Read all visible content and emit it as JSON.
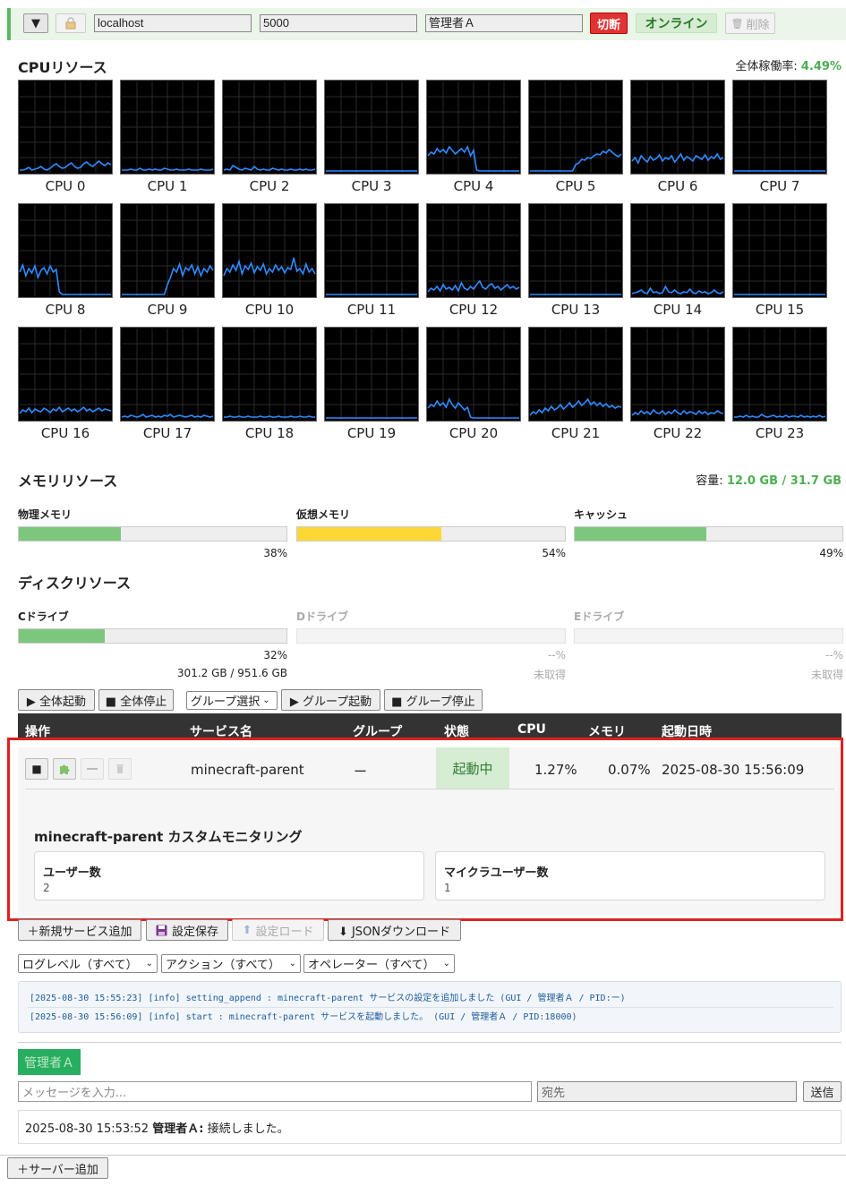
{
  "topbar": {
    "toggle_icon": "▼",
    "host_value": "localhost",
    "port_value": "5000",
    "operator_value": "管理者Ａ",
    "disconnect_label": "切断",
    "online_label": "オンライン",
    "delete_label": "削除"
  },
  "cpu_section": {
    "title": "CPUリソース",
    "usage_label": "全体稼働率:",
    "usage_value": "4.49%",
    "cores": [
      {
        "label": "CPU 0",
        "series": [
          2,
          2,
          3,
          5,
          2,
          3,
          4,
          6,
          3,
          2,
          4,
          7,
          9,
          6,
          4,
          5,
          8,
          10,
          6,
          4,
          5,
          9,
          11,
          8,
          6,
          9,
          12,
          9,
          7,
          10,
          8
        ]
      },
      {
        "label": "CPU 1",
        "series": [
          2,
          2,
          2,
          3,
          2,
          2,
          4,
          2,
          2,
          3,
          2,
          3,
          2,
          2,
          4,
          3,
          2,
          2,
          3,
          2,
          2,
          2,
          3,
          2,
          2,
          2,
          3,
          2,
          2,
          2,
          3
        ]
      },
      {
        "label": "CPU 2",
        "series": [
          2,
          3,
          2,
          7,
          5,
          3,
          2,
          4,
          3,
          2,
          6,
          3,
          2,
          3,
          2,
          2,
          4,
          3,
          2,
          3,
          2,
          2,
          3,
          2,
          2,
          3,
          2,
          3,
          2,
          2,
          3
        ]
      },
      {
        "label": "CPU 3",
        "series": [
          1,
          1,
          1,
          1,
          1,
          1,
          1,
          1,
          1,
          1,
          1,
          1,
          1,
          1,
          1,
          1,
          1,
          1,
          1,
          1,
          1,
          1,
          1,
          1,
          1,
          1,
          1,
          1,
          1,
          1,
          1
        ]
      },
      {
        "label": "CPU 4",
        "series": [
          18,
          22,
          20,
          26,
          22,
          25,
          21,
          28,
          24,
          20,
          23,
          26,
          22,
          28,
          18,
          24,
          2,
          1,
          1,
          1,
          1,
          1,
          1,
          1,
          1,
          1,
          1,
          1,
          1,
          1,
          1
        ]
      },
      {
        "label": "CPU 5",
        "series": [
          1,
          1,
          1,
          1,
          1,
          1,
          1,
          1,
          1,
          1,
          1,
          1,
          1,
          1,
          1,
          8,
          10,
          14,
          13,
          16,
          15,
          18,
          20,
          19,
          23,
          21,
          25,
          22,
          19,
          17,
          20
        ]
      },
      {
        "label": "CPU 6",
        "series": [
          12,
          16,
          10,
          18,
          14,
          11,
          17,
          13,
          15,
          19,
          12,
          16,
          14,
          18,
          11,
          15,
          20,
          13,
          17,
          15,
          12,
          18,
          16,
          14,
          19,
          13,
          17,
          15,
          20,
          14,
          16
        ]
      },
      {
        "label": "CPU 7",
        "series": [
          1,
          1,
          1,
          1,
          1,
          1,
          1,
          1,
          1,
          1,
          1,
          1,
          1,
          1,
          1,
          1,
          1,
          1,
          1,
          1,
          1,
          1,
          1,
          1,
          1,
          1,
          1,
          1,
          1,
          1,
          1
        ]
      },
      {
        "label": "CPU 8",
        "series": [
          26,
          34,
          22,
          30,
          25,
          33,
          20,
          28,
          31,
          24,
          33,
          26,
          29,
          4,
          1,
          1,
          1,
          1,
          1,
          1,
          1,
          1,
          1,
          1,
          1,
          1,
          1,
          1,
          1,
          1,
          1
        ]
      },
      {
        "label": "CPU 9",
        "series": [
          1,
          1,
          1,
          1,
          1,
          1,
          1,
          1,
          1,
          1,
          1,
          1,
          1,
          1,
          1,
          12,
          20,
          30,
          26,
          35,
          22,
          31,
          28,
          34,
          24,
          32,
          22,
          30,
          26,
          33,
          28
        ]
      },
      {
        "label": "CPU 10",
        "series": [
          22,
          30,
          26,
          34,
          28,
          38,
          24,
          33,
          29,
          36,
          25,
          32,
          28,
          35,
          24,
          30,
          26,
          34,
          28,
          32,
          25,
          31,
          29,
          42,
          27,
          30,
          24,
          35,
          26,
          30,
          24
        ]
      },
      {
        "label": "CPU 11",
        "series": [
          1,
          1,
          1,
          1,
          1,
          1,
          1,
          1,
          1,
          1,
          1,
          1,
          1,
          1,
          1,
          1,
          1,
          1,
          1,
          1,
          1,
          1,
          1,
          1,
          1,
          1,
          1,
          1,
          1,
          1,
          1
        ]
      },
      {
        "label": "CPU 12",
        "series": [
          4,
          8,
          6,
          10,
          5,
          12,
          7,
          9,
          6,
          11,
          5,
          14,
          8,
          6,
          10,
          7,
          12,
          16,
          9,
          7,
          11,
          13,
          8,
          10,
          6,
          9,
          12,
          8,
          10,
          7,
          9
        ]
      },
      {
        "label": "CPU 13",
        "series": [
          1,
          1,
          1,
          1,
          1,
          1,
          1,
          1,
          1,
          1,
          1,
          1,
          1,
          1,
          1,
          1,
          1,
          1,
          1,
          1,
          1,
          1,
          1,
          1,
          1,
          1,
          1,
          1,
          1,
          1,
          1
        ]
      },
      {
        "label": "CPU 14",
        "series": [
          2,
          3,
          4,
          6,
          3,
          2,
          8,
          3,
          4,
          2,
          3,
          10,
          4,
          3,
          6,
          3,
          2,
          4,
          3,
          7,
          3,
          2,
          5,
          3,
          4,
          2,
          3,
          6,
          3,
          2,
          4
        ]
      },
      {
        "label": "CPU 15",
        "series": [
          1,
          1,
          1,
          1,
          1,
          1,
          1,
          1,
          1,
          1,
          1,
          1,
          1,
          1,
          1,
          1,
          1,
          1,
          1,
          1,
          1,
          1,
          1,
          1,
          1,
          1,
          1,
          1,
          1,
          1,
          1
        ]
      },
      {
        "label": "CPU 16",
        "series": [
          6,
          10,
          8,
          12,
          7,
          11,
          9,
          8,
          12,
          10,
          7,
          11,
          9,
          13,
          8,
          10,
          12,
          9,
          11,
          8,
          10,
          13,
          9,
          11,
          8,
          10,
          12,
          9,
          11,
          10,
          9
        ]
      },
      {
        "label": "CPU 17",
        "series": [
          2,
          3,
          2,
          4,
          3,
          2,
          3,
          5,
          2,
          3,
          4,
          2,
          3,
          2,
          4,
          3,
          5,
          2,
          3,
          4,
          3,
          2,
          3,
          4,
          2,
          3,
          2,
          4,
          3,
          2,
          3
        ]
      },
      {
        "label": "CPU 18",
        "series": [
          2,
          2,
          3,
          2,
          2,
          3,
          2,
          2,
          3,
          2,
          2,
          2,
          3,
          2,
          2,
          3,
          2,
          2,
          3,
          2,
          2,
          2,
          3,
          2,
          2,
          3,
          2,
          2,
          3,
          2,
          2
        ]
      },
      {
        "label": "CPU 19",
        "series": [
          1,
          1,
          1,
          1,
          1,
          1,
          1,
          1,
          1,
          1,
          1,
          1,
          1,
          1,
          1,
          1,
          1,
          1,
          1,
          1,
          1,
          1,
          1,
          1,
          1,
          1,
          1,
          1,
          1,
          1,
          1
        ]
      },
      {
        "label": "CPU 20",
        "series": [
          12,
          16,
          14,
          20,
          15,
          18,
          13,
          22,
          16,
          12,
          18,
          14,
          10,
          13,
          2,
          1,
          1,
          1,
          1,
          1,
          1,
          1,
          1,
          1,
          1,
          1,
          1,
          1,
          1,
          1,
          1
        ]
      },
      {
        "label": "CPU 21",
        "series": [
          4,
          8,
          6,
          10,
          7,
          12,
          9,
          14,
          10,
          12,
          16,
          11,
          14,
          18,
          13,
          16,
          20,
          15,
          18,
          22,
          16,
          19,
          15,
          18,
          14,
          17,
          13,
          15,
          12,
          14,
          13
        ]
      },
      {
        "label": "CPU 22",
        "series": [
          4,
          7,
          5,
          9,
          6,
          8,
          5,
          10,
          7,
          6,
          9,
          5,
          8,
          6,
          10,
          7,
          5,
          9,
          6,
          8,
          7,
          5,
          9,
          6,
          8,
          5,
          7,
          6,
          9,
          7,
          6
        ]
      },
      {
        "label": "CPU 23",
        "series": [
          2,
          2,
          3,
          2,
          4,
          2,
          3,
          2,
          2,
          5,
          3,
          2,
          3,
          4,
          2,
          3,
          2,
          4,
          2,
          3,
          3,
          2,
          4,
          2,
          3,
          2,
          3,
          2,
          4,
          2,
          3
        ]
      }
    ]
  },
  "memory_section": {
    "title": "メモリリソース",
    "capacity_label": "容量:",
    "capacity_value": "12.0 GB / 31.7 GB",
    "meters": [
      {
        "title": "物理メモリ",
        "percent_text": "38%",
        "fraction": 0.38,
        "color": "#7dc67d"
      },
      {
        "title": "仮想メモリ",
        "percent_text": "54%",
        "fraction": 0.54,
        "color": "#fdd835"
      },
      {
        "title": "キャッシュ",
        "percent_text": "49%",
        "fraction": 0.49,
        "color": "#7dc67d"
      }
    ]
  },
  "disk_section": {
    "title": "ディスクリソース",
    "drives": [
      {
        "title": "Cドライブ",
        "percent_text": "32%",
        "fraction": 0.32,
        "detail": "301.2 GB / 951.6 GB",
        "color": "#7dc67d"
      },
      {
        "title": "Dドライブ",
        "percent_text": "--%",
        "fraction": 0,
        "detail": "未取得",
        "color": "#cccccc"
      },
      {
        "title": "Eドライブ",
        "percent_text": "--%",
        "fraction": 0,
        "detail": "未取得",
        "color": "#cccccc"
      }
    ]
  },
  "group_toolbar": {
    "start_all": "▶ 全体起動",
    "stop_all": "■ 全体停止",
    "group_select": "グループ選択",
    "group_start": "▶ グループ起動",
    "group_stop": "■ グループ停止"
  },
  "service_table": {
    "headers": [
      "操作",
      "サービス名",
      "グループ",
      "状態",
      "CPU",
      "メモリ",
      "起動日時"
    ],
    "row": {
      "stop_icon": "■",
      "name": "minecraft-parent",
      "group": "ー",
      "status": "起動中",
      "cpu": "1.27%",
      "memory": "0.07%",
      "started_at": "2025-08-30 15:56:09"
    },
    "custom_monitor": {
      "title": "minecraft-parent カスタムモニタリング",
      "cards": [
        {
          "label": "ユーザー数",
          "value": "2"
        },
        {
          "label": "マイクラユーザー数",
          "value": "1"
        }
      ]
    }
  },
  "config_toolbar": {
    "add_service": "＋新規サービス追加",
    "save_config": "設定保存",
    "load_config": "設定ロード",
    "download_json": "⬇ JSONダウンロード"
  },
  "log_filters": {
    "level": "ログレベル（すべて）",
    "action": "アクション（すべて）",
    "operator": "オペレーター（すべて）"
  },
  "logs": [
    "[2025-08-30 15:55:23] [info] setting_append : minecraft-parent サービスの設定を追加しました (GUI / 管理者Ａ / PID:ー)",
    "[2025-08-30 15:56:09] [info] start : minecraft-parent サービスを起動しました。 (GUI / 管理者Ａ / PID:18000)"
  ],
  "chat": {
    "user_tag": "管理者Ａ",
    "message_placeholder": "メッセージを入力...",
    "to_placeholder": "宛先",
    "send_label": "送信",
    "messages": [
      {
        "time": "2025-08-30 15:53:52",
        "user": "管理者Ａ:",
        "text": "接続しました。"
      }
    ]
  },
  "footer": {
    "add_server": "＋サーバー追加"
  }
}
